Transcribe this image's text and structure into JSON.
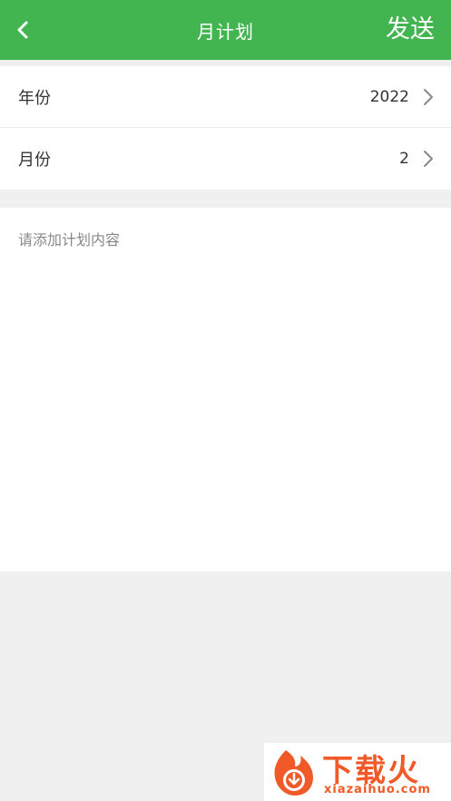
{
  "header": {
    "title": "月计划",
    "send_label": "发送"
  },
  "form": {
    "rows": [
      {
        "label": "年份",
        "value": "2022"
      },
      {
        "label": "月份",
        "value": "2"
      }
    ]
  },
  "content": {
    "placeholder": "请添加计划内容"
  },
  "watermark": {
    "title": "下载火",
    "url": "xiazaihuo.com"
  },
  "colors": {
    "header_bg": "#42b550",
    "page_bg": "#f0f0f0",
    "watermark": "#f05a28"
  },
  "icons": {
    "back": "chevron-left-icon",
    "row_arrow": "chevron-right-icon",
    "logo": "flame-download-logo"
  }
}
